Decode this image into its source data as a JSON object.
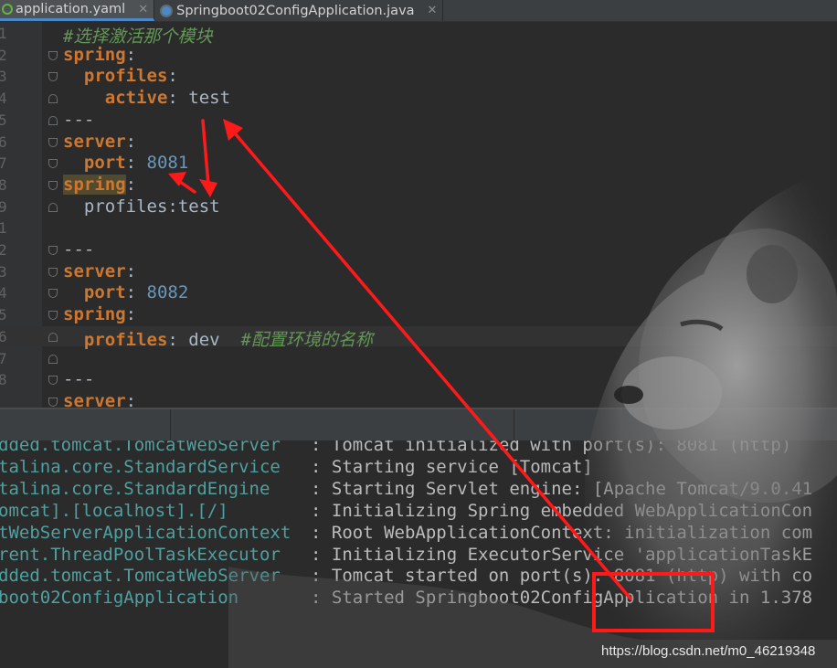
{
  "tabs": [
    {
      "label": "application.yaml",
      "icon": "yaml-file-icon",
      "active": true
    },
    {
      "label": "Springboot02ConfigApplication.java",
      "icon": "java-class-icon",
      "active": false
    }
  ],
  "editor": {
    "line_numbers": [
      "1",
      "2",
      "3",
      "4",
      "5",
      "6",
      "7",
      "8",
      "9",
      "1",
      "2",
      "3",
      "4",
      "5",
      "6",
      "7",
      "8"
    ],
    "lines": [
      {
        "comment": "#选择激活那个模块"
      },
      {
        "key": "spring",
        "sep": ":"
      },
      {
        "indent": "  ",
        "key": "profiles",
        "sep": ":"
      },
      {
        "indent": "    ",
        "key": "active",
        "sep": ":",
        "value": " test"
      },
      {
        "plain": "---"
      },
      {
        "key": "server",
        "sep": ":"
      },
      {
        "indent": "  ",
        "key": "port",
        "sep": ":",
        "number": " 8081"
      },
      {
        "key": "spring",
        "sep": ":",
        "highlight": true
      },
      {
        "indent": "  ",
        "plain": "profiles:test"
      },
      {
        "plain": ""
      },
      {
        "plain": "---"
      },
      {
        "key": "server",
        "sep": ":"
      },
      {
        "indent": "  ",
        "key": "port",
        "sep": ":",
        "number": " 8082"
      },
      {
        "key": "spring",
        "sep": ":"
      },
      {
        "indent": "  ",
        "key": "profiles",
        "sep": ":",
        "value": " dev  ",
        "comment": "#配置环境的名称"
      },
      {
        "plain": ""
      },
      {
        "plain": "---"
      },
      {
        "key": "server",
        "sep": ":"
      }
    ]
  },
  "console": [
    {
      "source": "dded.tomcat.TomcatWebServer",
      "message": ": Tomcat initialized with port(s): 8081 (http)"
    },
    {
      "source": "talina.core.StandardService",
      "message": ": Starting service [Tomcat]"
    },
    {
      "source": "talina.core.StandardEngine",
      "message": ": Starting Servlet engine: [Apache Tomcat/9.0.41"
    },
    {
      "source": "omcat].[localhost].[/]",
      "message": ": Initializing Spring embedded WebApplicationCon"
    },
    {
      "source": "tWebServerApplicationContext",
      "message": ": Root WebApplicationContext: initialization com"
    },
    {
      "source": "rent.ThreadPoolTaskExecutor",
      "message": ": Initializing ExecutorService 'applicationTaskE"
    },
    {
      "source": "dded.tomcat.TomcatWebServer",
      "message": ": Tomcat started on port(s): 8081 (http) with co"
    },
    {
      "source": "boot02ConfigApplication",
      "message": ": Started Springboot02ConfigApplication in 1.378"
    }
  ],
  "watermark": "https://blog.csdn.net/m0_46219348",
  "colors": {
    "annotation": "#ff1a1a",
    "key": "#cc7832",
    "number": "#6897bb",
    "comment": "#629755",
    "console_source": "#4fa0a0"
  }
}
